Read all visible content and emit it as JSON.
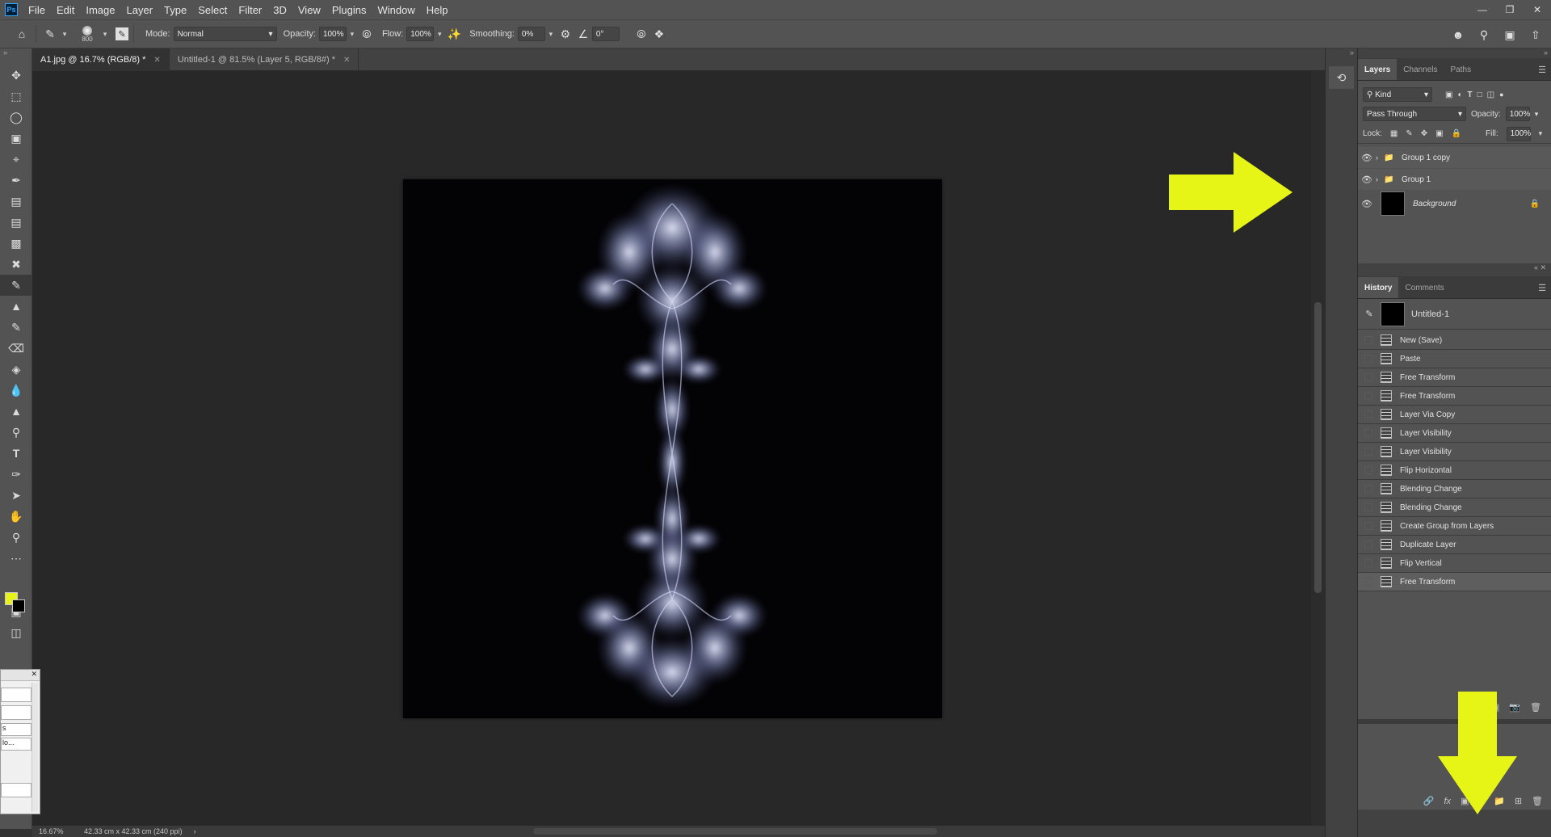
{
  "menu": {
    "logo": "Ps",
    "items": [
      "File",
      "Edit",
      "Image",
      "Layer",
      "Type",
      "Select",
      "Filter",
      "3D",
      "View",
      "Plugins",
      "Window",
      "Help"
    ]
  },
  "options": {
    "brush_size": "800",
    "mode_label": "Mode:",
    "mode_value": "Normal",
    "opacity_label": "Opacity:",
    "opacity_value": "100%",
    "flow_label": "Flow:",
    "flow_value": "100%",
    "smoothing_label": "Smoothing:",
    "smoothing_value": "0%",
    "angle_value": "0°"
  },
  "tabs": [
    {
      "label": "A1.jpg @ 16.7% (RGB/8) *"
    },
    {
      "label": "Untitled-1 @ 81.5% (Layer 5, RGB/8#) *"
    }
  ],
  "status": {
    "zoom": "16.67%",
    "doc_info": "42.33 cm x 42.33 cm (240 ppi)"
  },
  "layers_panel": {
    "tabs": [
      "Layers",
      "Channels",
      "Paths"
    ],
    "filter_value": "Kind",
    "blend_mode": "Pass Through",
    "opacity_label": "Opacity:",
    "opacity_value": "100%",
    "lock_label": "Lock:",
    "fill_label": "Fill:",
    "fill_value": "100%",
    "layers": [
      {
        "name": "Group 1 copy"
      },
      {
        "name": "Group 1"
      },
      {
        "name": "Background"
      }
    ]
  },
  "history_panel": {
    "tabs": [
      "History",
      "Comments"
    ],
    "snapshot": "Untitled-1",
    "items": [
      "New (Save)",
      "Paste",
      "Free Transform",
      "Free Transform",
      "Layer Via Copy",
      "Layer Visibility",
      "Layer Visibility",
      "Flip Horizontal",
      "Blending Change",
      "Blending Change",
      "Create Group from Layers",
      "Duplicate Layer",
      "Flip Vertical",
      "Free Transform"
    ]
  },
  "dialog_fragment": {
    "line1": "s",
    "line2": "lo..."
  },
  "colors": {
    "foreground": "#e7f21a",
    "background": "#000000",
    "arrow": "#e6f516"
  }
}
